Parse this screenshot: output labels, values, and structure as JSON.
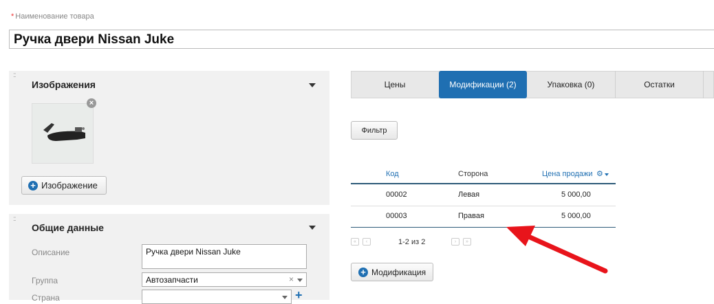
{
  "product": {
    "name_label": "Наименование товара",
    "required_mark": "*",
    "name_value": "Ручка двери Nissan Juke"
  },
  "images_panel": {
    "title": "Изображения",
    "add_image_label": "Изображение"
  },
  "general_panel": {
    "title": "Общие данные",
    "description_label": "Описание",
    "description_value": "Ручка двери Nissan Juke",
    "group_label": "Группа",
    "group_value": "Автозапчасти",
    "country_label": "Страна",
    "country_value": ""
  },
  "tabs": [
    {
      "label": "Цены",
      "active": false
    },
    {
      "label": "Модификации (2)",
      "active": true
    },
    {
      "label": "Упаковка (0)",
      "active": false
    },
    {
      "label": "Остатки",
      "active": false
    }
  ],
  "filter_label": "Фильтр",
  "table": {
    "columns": [
      "Код",
      "Сторона",
      "Цена продажи"
    ],
    "rows": [
      {
        "code": "00002",
        "side": "Левая",
        "price": "5 000,00"
      },
      {
        "code": "00003",
        "side": "Правая",
        "price": "5 000,00"
      }
    ]
  },
  "pager": {
    "text": "1-2 из 2"
  },
  "add_modification_label": "Модификация",
  "colors": {
    "accent": "#1f6fb2",
    "arrow": "#e8141b",
    "panel": "#f1f1f1"
  },
  "icons": [
    "drag-handle-icon",
    "caret-down-icon",
    "remove-icon",
    "plus-circle-icon",
    "gear-icon",
    "clear-icon",
    "arrow-annotation-icon"
  ]
}
